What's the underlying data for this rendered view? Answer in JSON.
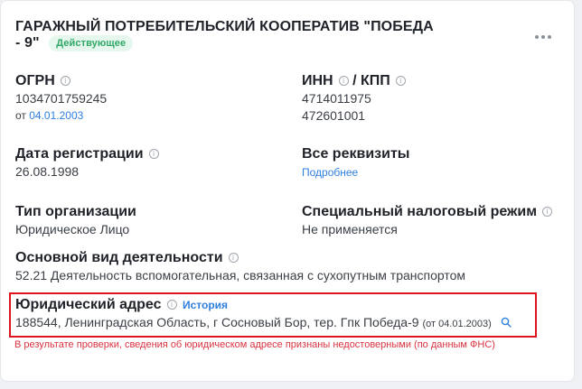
{
  "company": {
    "title": "ГАРАЖНЫЙ ПОТРЕБИТЕЛЬСКИЙ КООПЕРАТИВ \"ПОБЕДА - 9\"",
    "status_badge": "Действующее"
  },
  "info_icon_glyph": "i",
  "ogrn": {
    "label": "ОГРН",
    "value": "1034701759245",
    "from_prefix": "от",
    "from_date": "04.01.2003"
  },
  "inn_kpp": {
    "inn_label": "ИНН",
    "separator": "/",
    "kpp_label": "КПП",
    "inn": "4714011975",
    "kpp": "472601001"
  },
  "registration": {
    "label": "Дата регистрации",
    "value": "26.08.1998"
  },
  "requisites": {
    "label": "Все реквизиты",
    "link": "Подробнее"
  },
  "org_type": {
    "label": "Тип организации",
    "value": "Юридическое Лицо"
  },
  "tax_regime": {
    "label": "Специальный налоговый режим",
    "value": "Не применяется"
  },
  "activity": {
    "label": "Основной вид деятельности",
    "value": "52.21 Деятельность вспомогательная, связанная с сухопутным транспортом"
  },
  "address": {
    "label": "Юридический адрес",
    "history_link": "История",
    "value": "188544, Ленинградская Область, г Сосновый Бор, тер. Гпк Победа-9",
    "date_note": "(от 04.01.2003)",
    "warning": "В результате проверки, сведения об юридическом адресе признаны недостоверными (по данным ФНС)"
  },
  "colors": {
    "accent_link": "#2f7fe0",
    "badge_bg": "#e6f7ee",
    "badge_text": "#2fa866",
    "highlight_border": "#e0141e",
    "warning_text": "#d9323f"
  },
  "icons": [
    "info-icon",
    "search-icon",
    "more-options-icon"
  ]
}
